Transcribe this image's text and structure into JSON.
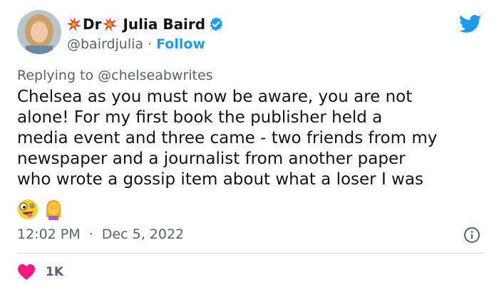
{
  "author": {
    "name_prefix": "Dr",
    "name_last": "Julia Baird",
    "handle": "@bairdjulia",
    "separator": "·",
    "follow_label": "Follow"
  },
  "reply": {
    "prefix": "Replying to",
    "mention": "@chelseabwrites"
  },
  "tweet": {
    "lines": [
      "Chelsea as you must now be aware, you are not",
      "alone! For my first book the publisher held a",
      "media event and three came - two friends from my",
      "newspaper and a journalist from another paper",
      "who wrote a gossip item about what a loser I was"
    ],
    "emojis": [
      "zany-face",
      "woman-facepalming"
    ]
  },
  "meta": {
    "time": "12:02 PM",
    "separator": "·",
    "date": "Dec 5, 2022"
  },
  "engagement": {
    "likes": "1K"
  },
  "colors": {
    "accent": "#1d9bf0",
    "like": "#f91880",
    "muted": "#536471",
    "text": "#0f1419"
  }
}
